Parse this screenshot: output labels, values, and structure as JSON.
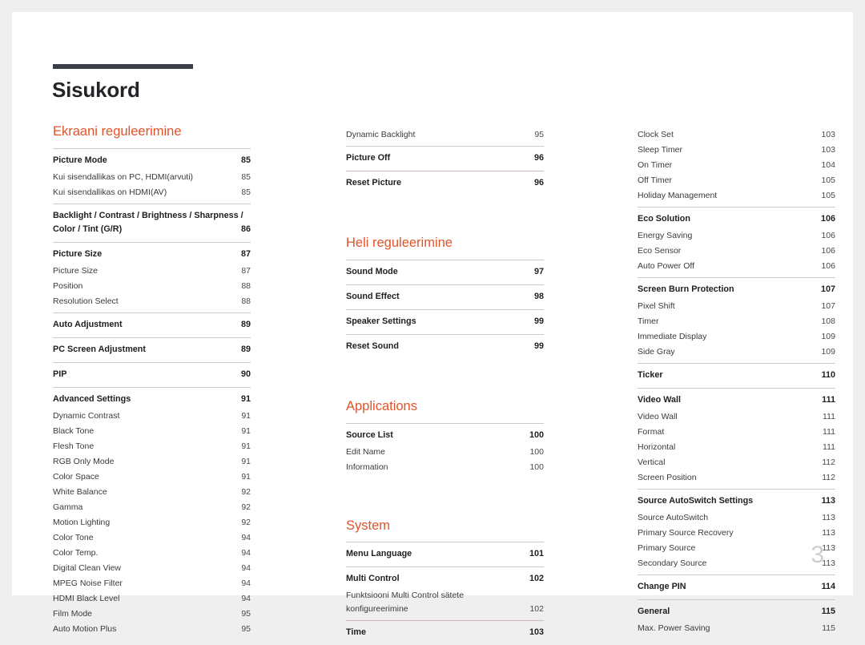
{
  "document": {
    "title": "Sisukord",
    "folio": "3",
    "accent_color": "#e0532a",
    "rule_color": "#3b3d47",
    "divider_color": "#cbcbcb",
    "page_background": "#ffffff",
    "canvas_background": "#efefef"
  },
  "columns": [
    {
      "id": "column-1",
      "sections": [
        {
          "heading": "Ekraani reguleerimine",
          "groups": [
            {
              "entries": [
                {
                  "label": "Picture Mode",
                  "page": "85",
                  "level": "major"
                },
                {
                  "label": "Kui sisendallikas on PC, HDMI(arvuti)",
                  "page": "85",
                  "level": "sub"
                },
                {
                  "label": "Kui sisendallikas on HDMI(AV)",
                  "page": "85",
                  "level": "sub"
                }
              ]
            },
            {
              "entries": [
                {
                  "label": "Backlight / Contrast / Brightness / Sharpness /",
                  "label2": "Color / Tint (G/R)",
                  "page": "86",
                  "level": "major-wrap"
                }
              ]
            },
            {
              "entries": [
                {
                  "label": "Picture Size",
                  "page": "87",
                  "level": "major"
                },
                {
                  "label": "Picture Size",
                  "page": "87",
                  "level": "sub"
                },
                {
                  "label": "Position",
                  "page": "88",
                  "level": "sub"
                },
                {
                  "label": "Resolution Select",
                  "page": "88",
                  "level": "sub"
                }
              ]
            },
            {
              "entries": [
                {
                  "label": "Auto Adjustment",
                  "page": "89",
                  "level": "major"
                }
              ]
            },
            {
              "entries": [
                {
                  "label": "PC Screen Adjustment",
                  "page": "89",
                  "level": "major"
                }
              ]
            },
            {
              "entries": [
                {
                  "label": "PIP",
                  "page": "90",
                  "level": "major"
                }
              ]
            },
            {
              "entries": [
                {
                  "label": "Advanced Settings",
                  "page": "91",
                  "level": "major"
                },
                {
                  "label": "Dynamic Contrast",
                  "page": "91",
                  "level": "sub"
                },
                {
                  "label": "Black Tone",
                  "page": "91",
                  "level": "sub"
                },
                {
                  "label": "Flesh Tone",
                  "page": "91",
                  "level": "sub"
                },
                {
                  "label": "RGB Only Mode",
                  "page": "91",
                  "level": "sub"
                },
                {
                  "label": "Color Space",
                  "page": "91",
                  "level": "sub"
                },
                {
                  "label": "White Balance",
                  "page": "92",
                  "level": "sub"
                },
                {
                  "label": "Gamma",
                  "page": "92",
                  "level": "sub"
                },
                {
                  "label": "Motion Lighting",
                  "page": "92",
                  "level": "sub"
                },
                {
                  "label": "Color Tone",
                  "page": "94",
                  "level": "sub"
                },
                {
                  "label": "Color Temp.",
                  "page": "94",
                  "level": "sub"
                },
                {
                  "label": "Digital Clean View",
                  "page": "94",
                  "level": "sub"
                },
                {
                  "label": "MPEG Noise Filter",
                  "page": "94",
                  "level": "sub"
                },
                {
                  "label": "HDMI Black Level",
                  "page": "94",
                  "level": "sub"
                },
                {
                  "label": "Film Mode",
                  "page": "95",
                  "level": "sub"
                },
                {
                  "label": "Auto Motion Plus",
                  "page": "95",
                  "level": "sub"
                }
              ]
            }
          ]
        }
      ]
    },
    {
      "id": "column-2",
      "sections": [
        {
          "heading": null,
          "groups": [
            {
              "no_rule": true,
              "entries": [
                {
                  "label": "Dynamic Backlight",
                  "page": "95",
                  "level": "sub"
                }
              ]
            },
            {
              "entries": [
                {
                  "label": "Picture Off",
                  "page": "96",
                  "level": "major"
                }
              ]
            },
            {
              "warm": true,
              "entries": [
                {
                  "label": "Reset Picture",
                  "page": "96",
                  "level": "major"
                }
              ]
            }
          ]
        },
        {
          "heading": "Heli reguleerimine",
          "groups": [
            {
              "entries": [
                {
                  "label": "Sound Mode",
                  "page": "97",
                  "level": "major"
                }
              ]
            },
            {
              "entries": [
                {
                  "label": "Sound Effect",
                  "page": "98",
                  "level": "major"
                }
              ]
            },
            {
              "entries": [
                {
                  "label": "Speaker Settings",
                  "page": "99",
                  "level": "major"
                }
              ]
            },
            {
              "entries": [
                {
                  "label": "Reset Sound",
                  "page": "99",
                  "level": "major"
                }
              ]
            }
          ]
        },
        {
          "heading": "Applications",
          "groups": [
            {
              "entries": [
                {
                  "label": "Source List",
                  "page": "100",
                  "level": "major"
                },
                {
                  "label": "Edit Name",
                  "page": "100",
                  "level": "sub"
                },
                {
                  "label": "Information",
                  "page": "100",
                  "level": "sub"
                }
              ]
            }
          ]
        },
        {
          "heading": "System",
          "groups": [
            {
              "entries": [
                {
                  "label": "Menu Language",
                  "page": "101",
                  "level": "major"
                }
              ]
            },
            {
              "entries": [
                {
                  "label": "Multi Control",
                  "page": "102",
                  "level": "major"
                },
                {
                  "label": "Funktsiooni Multi Control sätete",
                  "label2": "konfigureerimine",
                  "page": "102",
                  "level": "sub-wrap"
                }
              ]
            },
            {
              "warm": true,
              "entries": [
                {
                  "label": "Time",
                  "page": "103",
                  "level": "major"
                }
              ]
            }
          ]
        }
      ]
    },
    {
      "id": "column-3",
      "sections": [
        {
          "heading": null,
          "groups": [
            {
              "no_rule": true,
              "entries": [
                {
                  "label": "Clock Set",
                  "page": "103",
                  "level": "sub"
                },
                {
                  "label": "Sleep Timer",
                  "page": "103",
                  "level": "sub"
                },
                {
                  "label": "On Timer",
                  "page": "104",
                  "level": "sub"
                },
                {
                  "label": "Off Timer",
                  "page": "105",
                  "level": "sub"
                },
                {
                  "label": "Holiday Management",
                  "page": "105",
                  "level": "sub"
                }
              ]
            },
            {
              "entries": [
                {
                  "label": "Eco Solution",
                  "page": "106",
                  "level": "major"
                },
                {
                  "label": "Energy Saving",
                  "page": "106",
                  "level": "sub"
                },
                {
                  "label": "Eco Sensor",
                  "page": "106",
                  "level": "sub"
                },
                {
                  "label": "Auto Power Off",
                  "page": "106",
                  "level": "sub"
                }
              ]
            },
            {
              "entries": [
                {
                  "label": "Screen Burn Protection",
                  "page": "107",
                  "level": "major"
                },
                {
                  "label": "Pixel Shift",
                  "page": "107",
                  "level": "sub"
                },
                {
                  "label": "Timer",
                  "page": "108",
                  "level": "sub"
                },
                {
                  "label": "Immediate Display",
                  "page": "109",
                  "level": "sub"
                },
                {
                  "label": "Side Gray",
                  "page": "109",
                  "level": "sub"
                }
              ]
            },
            {
              "entries": [
                {
                  "label": "Ticker",
                  "page": "110",
                  "level": "major"
                }
              ]
            },
            {
              "entries": [
                {
                  "label": "Video Wall",
                  "page": "111",
                  "level": "major"
                },
                {
                  "label": "Video Wall",
                  "page": "111",
                  "level": "sub"
                },
                {
                  "label": "Format",
                  "page": "111",
                  "level": "sub"
                },
                {
                  "label": "Horizontal",
                  "page": "111",
                  "level": "sub"
                },
                {
                  "label": "Vertical",
                  "page": "112",
                  "level": "sub"
                },
                {
                  "label": "Screen Position",
                  "page": "112",
                  "level": "sub"
                }
              ]
            },
            {
              "entries": [
                {
                  "label": "Source AutoSwitch Settings",
                  "page": "113",
                  "level": "major"
                },
                {
                  "label": "Source AutoSwitch",
                  "page": "113",
                  "level": "sub"
                },
                {
                  "label": "Primary Source Recovery",
                  "page": "113",
                  "level": "sub"
                },
                {
                  "label": "Primary Source",
                  "page": "113",
                  "level": "sub"
                },
                {
                  "label": "Secondary Source",
                  "page": "113",
                  "level": "sub"
                }
              ]
            },
            {
              "entries": [
                {
                  "label": "Change PIN",
                  "page": "114",
                  "level": "major"
                }
              ]
            },
            {
              "entries": [
                {
                  "label": "General",
                  "page": "115",
                  "level": "major"
                },
                {
                  "label": "Max. Power Saving",
                  "page": "115",
                  "level": "sub"
                }
              ]
            }
          ]
        }
      ]
    }
  ]
}
